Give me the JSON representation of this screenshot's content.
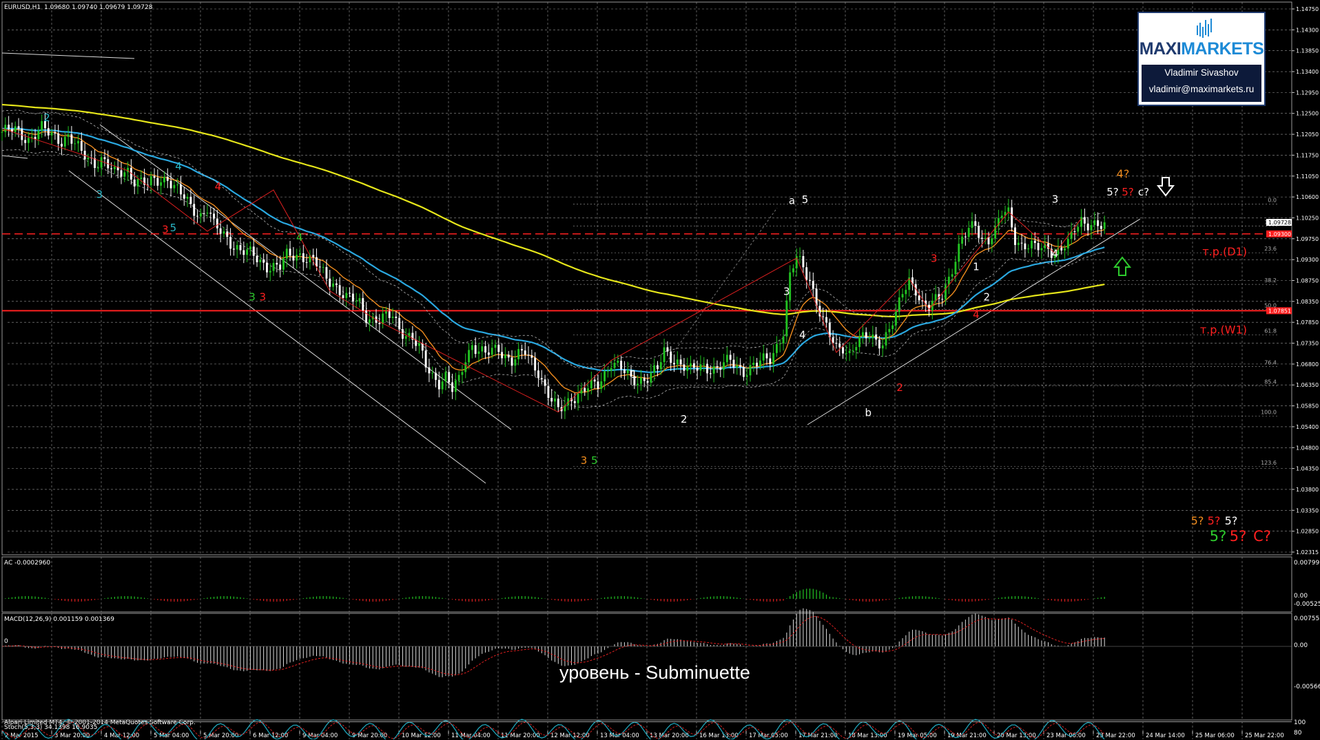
{
  "header": {
    "symbol": "EURUSD,H1",
    "ohlc": "1.09680 1.09740 1.09679 1.09728"
  },
  "logo": {
    "brand_part1": "MAXI",
    "brand_part2": "MARKETS",
    "author": "Vladimir Sivashov",
    "email": "vladimir@maximarkets.ru"
  },
  "footer": {
    "copyright": "Alpari Limited MT4, © 2001-2014 MetaQuotes Software Corp.",
    "level_label": "уровень - Subminuette"
  },
  "indicators": {
    "ac_label": "AC -0.0002960",
    "macd_label": "MACD(12,26,9) 0.001159 0.001369",
    "stoch_label": "Stoch(5,3,3) 34.1398 16.9035",
    "ac_scale": [
      "0.0079954",
      "0.00",
      "-0.005259"
    ],
    "macd_scale": [
      "0.0075534",
      "0.00",
      "-0.005667"
    ],
    "stoch_scale": [
      "100",
      "80",
      "20",
      "0"
    ],
    "macd_zero": "0"
  },
  "colors": {
    "background": "#000000",
    "ema_slow": "#e6e61a",
    "ema_mid": "#2aa8e0",
    "ema_fast": "#f08c1e",
    "bull": "#22c322",
    "level_red": "#ff2020",
    "stoch_main": "#1fa3b8",
    "stoch_signal": "#d02020"
  },
  "chart_data": {
    "type": "candlestick",
    "symbol": "EURUSD",
    "timeframe": "H1",
    "price_axis_ticks": [
      "1.14750",
      "1.14300",
      "1.13850",
      "1.13400",
      "1.12950",
      "1.12500",
      "1.12050",
      "1.11750",
      "1.11050",
      "1.10600",
      "1.10250",
      "1.09750",
      "1.09300",
      "1.08750",
      "1.08350",
      "1.07850",
      "1.07350",
      "1.06800",
      "1.06350",
      "1.05850",
      "1.05400",
      "1.04800",
      "1.04350",
      "1.03800",
      "1.03350",
      "1.02850",
      "1.02315"
    ],
    "price_range": [
      1.0229,
      1.1488
    ],
    "current_price_tag": "1.09728",
    "level_tags": [
      "1.09300",
      "1.07851"
    ],
    "time_labels": [
      "2 Mar 2015",
      "3 Mar 20:00",
      "4 Mar 12:00",
      "5 Mar 04:00",
      "5 Mar 20:00",
      "6 Mar 12:00",
      "9 Mar 04:00",
      "9 Mar 20:00",
      "10 Mar 12:00",
      "11 Mar 04:00",
      "11 Mar 20:00",
      "12 Mar 12:00",
      "13 Mar 04:00",
      "13 Mar 20:00",
      "16 Mar 13:00",
      "17 Mar 05:00",
      "17 Mar 21:00",
      "18 Mar 13:00",
      "19 Mar 05:00",
      "19 Mar 21:00",
      "20 Mar 13:00",
      "23 Mar 06:00",
      "23 Mar 22:00",
      "24 Mar 14:00",
      "25 Mar 06:00",
      "25 Mar 22:00"
    ],
    "fib_levels": [
      {
        "label": "0.0",
        "price": 1.1028
      },
      {
        "label": "11.8",
        "price": 1.0978
      },
      {
        "label": "23.6",
        "price": 1.0917
      },
      {
        "label": "38.2",
        "price": 1.0845
      },
      {
        "label": "50.0",
        "price": 1.0788
      },
      {
        "label": "61.8",
        "price": 1.073
      },
      {
        "label": "76.4",
        "price": 1.0658
      },
      {
        "label": "85.4",
        "price": 1.0614
      },
      {
        "label": "100.0",
        "price": 1.0545
      },
      {
        "label": "123.6",
        "price": 1.043
      }
    ],
    "horizontal_levels": [
      {
        "label": "т.р.(D1)",
        "price": 1.096,
        "style": "dashed"
      },
      {
        "label": "т.р.(W1)",
        "price": 1.0785,
        "style": "solid"
      }
    ],
    "close_path": [
      [
        0,
        1.1192
      ],
      [
        4,
        1.1194
      ],
      [
        8,
        1.1178
      ],
      [
        12,
        1.1198
      ],
      [
        14,
        1.1188
      ],
      [
        18,
        1.1176
      ],
      [
        20,
        1.1184
      ],
      [
        24,
        1.1141
      ],
      [
        28,
        1.1124
      ],
      [
        30,
        1.1132
      ],
      [
        34,
        1.1094
      ],
      [
        38,
        1.1108
      ],
      [
        40,
        1.1084
      ],
      [
        44,
        1.1068
      ],
      [
        46,
        1.1082
      ],
      [
        50,
        1.109
      ],
      [
        52,
        1.1064
      ],
      [
        56,
        1.1032
      ],
      [
        60,
        1.1004
      ],
      [
        62,
        1.1018
      ],
      [
        64,
        1.0976
      ],
      [
        68,
        1.0952
      ],
      [
        72,
        1.0922
      ],
      [
        76,
        1.0908
      ],
      [
        80,
        1.089
      ],
      [
        84,
        1.0882
      ],
      [
        86,
        1.0908
      ],
      [
        90,
        1.0916
      ],
      [
        94,
        1.0896
      ],
      [
        98,
        1.086
      ],
      [
        100,
        1.0852
      ],
      [
        104,
        1.0812
      ],
      [
        108,
        1.0802
      ],
      [
        110,
        1.0776
      ],
      [
        114,
        1.076
      ],
      [
        118,
        1.0774
      ],
      [
        120,
        1.0748
      ],
      [
        124,
        1.072
      ],
      [
        126,
        1.0696
      ],
      [
        128,
        1.066
      ],
      [
        130,
        1.064
      ],
      [
        132,
        1.0625
      ],
      [
        134,
        1.0634
      ],
      [
        136,
        1.0602
      ],
      [
        138,
        1.0624
      ],
      [
        140,
        1.068
      ],
      [
        142,
        1.071
      ],
      [
        146,
        1.0682
      ],
      [
        150,
        1.07
      ],
      [
        154,
        1.0672
      ],
      [
        158,
        1.0688
      ],
      [
        162,
        1.065
      ],
      [
        164,
        1.061
      ],
      [
        166,
        1.0578
      ],
      [
        168,
        1.0554
      ],
      [
        170,
        1.057
      ],
      [
        172,
        1.059
      ],
      [
        176,
        1.0604
      ],
      [
        180,
        1.0616
      ],
      [
        184,
        1.0672
      ],
      [
        186,
        1.0658
      ],
      [
        190,
        1.0626
      ],
      [
        194,
        1.0632
      ],
      [
        198,
        1.0648
      ],
      [
        200,
        1.069
      ],
      [
        204,
        1.0672
      ],
      [
        208,
        1.0646
      ],
      [
        212,
        1.066
      ],
      [
        216,
        1.0654
      ],
      [
        220,
        1.0668
      ],
      [
        224,
        1.065
      ],
      [
        228,
        1.0662
      ],
      [
        232,
        1.0676
      ],
      [
        236,
        1.074
      ],
      [
        238,
        1.086
      ],
      [
        240,
        1.0905
      ],
      [
        242,
        1.0882
      ],
      [
        244,
        1.086
      ],
      [
        246,
        1.0806
      ],
      [
        248,
        1.076
      ],
      [
        250,
        1.0724
      ],
      [
        252,
        1.0698
      ],
      [
        254,
        1.0706
      ],
      [
        256,
        1.069
      ],
      [
        258,
        1.071
      ],
      [
        262,
        1.0726
      ],
      [
        266,
        1.0716
      ],
      [
        270,
        1.077
      ],
      [
        272,
        1.0824
      ],
      [
        274,
        1.0858
      ],
      [
        276,
        1.0838
      ],
      [
        278,
        1.0798
      ],
      [
        280,
        1.0788
      ],
      [
        284,
        1.0824
      ],
      [
        286,
        1.0864
      ],
      [
        290,
        1.0944
      ],
      [
        292,
        1.0966
      ],
      [
        294,
        1.0984
      ],
      [
        296,
        1.0952
      ],
      [
        298,
        1.0948
      ],
      [
        300,
        1.0962
      ],
      [
        302,
        1.1004
      ],
      [
        304,
        1.101
      ],
      [
        306,
        1.0954
      ],
      [
        308,
        1.0934
      ],
      [
        312,
        1.0925
      ],
      [
        316,
        1.0934
      ],
      [
        318,
        1.0916
      ],
      [
        322,
        1.0932
      ],
      [
        324,
        1.0972
      ],
      [
        326,
        1.0995
      ],
      [
        330,
        1.0978
      ],
      [
        332,
        1.0972
      ]
    ],
    "bars_total": 334,
    "wave_labels": [
      {
        "text": "2",
        "bar": 17,
        "price": 1.1217,
        "color": "#2ab8c8"
      },
      {
        "text": "3",
        "bar": 37,
        "price": 1.1042,
        "color": "#2ab8c8"
      },
      {
        "text": "4",
        "bar": 67,
        "price": 1.1106,
        "color": "#2ab8c8"
      },
      {
        "text": "5",
        "bar": 65,
        "price": 1.0966,
        "color": "#2ab8c8"
      },
      {
        "text": "3",
        "bar": 62,
        "price": 1.0962,
        "color": "#ff2020"
      },
      {
        "text": "4",
        "bar": 82,
        "price": 1.106,
        "color": "#ff2020"
      },
      {
        "text": "4",
        "bar": 113,
        "price": 1.0944,
        "color": "#2ecc2e"
      },
      {
        "text": "3",
        "bar": 95,
        "price": 1.0808,
        "color": "#2ecc2e"
      },
      {
        "text": "3",
        "bar": 99,
        "price": 1.0808,
        "color": "#ff2020"
      },
      {
        "text": "3",
        "bar": 221,
        "price": 1.0436,
        "color": "#f08c1e"
      },
      {
        "text": "5",
        "bar": 225,
        "price": 1.0436,
        "color": "#2ecc2e"
      },
      {
        "text": "1",
        "bar": 240,
        "price": 1.0632,
        "color": "#ffffff"
      },
      {
        "text": "2",
        "bar": 259,
        "price": 1.053,
        "color": "#ffffff"
      },
      {
        "text": "a",
        "bar": 300,
        "price": 1.1028,
        "color": "#ffffff"
      },
      {
        "text": "5",
        "bar": 305,
        "price": 1.103,
        "color": "#ffffff"
      },
      {
        "text": "3",
        "bar": 298,
        "price": 1.0821,
        "color": "#ffffff"
      },
      {
        "text": "4",
        "bar": 304,
        "price": 1.0722,
        "color": "#ffffff"
      },
      {
        "text": "b",
        "bar": 329,
        "price": 1.0545,
        "color": "#ffffff"
      },
      {
        "text": "2",
        "bar": 341,
        "price": 1.0602,
        "color": "#ff2020"
      },
      {
        "text": "3",
        "bar": 354,
        "price": 1.0896,
        "color": "#ff2020"
      },
      {
        "text": "1",
        "bar": 370,
        "price": 1.0877,
        "color": "#ffffff"
      },
      {
        "text": "2",
        "bar": 374,
        "price": 1.0808,
        "color": "#ffffff"
      },
      {
        "text": "4",
        "bar": 370,
        "price": 1.0768,
        "color": "#ff2020"
      },
      {
        "text": "3",
        "bar": 400,
        "price": 1.1031,
        "color": "#ffffff"
      },
      {
        "text": "4",
        "bar": 400,
        "price": 1.0907,
        "color": "#ffffff"
      }
    ],
    "forecast_labels": [
      {
        "text": "4?",
        "color": "#f08c1e"
      },
      {
        "text": "5?",
        "color": "#ffffff"
      },
      {
        "text": "5?",
        "color": "#ff2020"
      },
      {
        "text": "c?",
        "color": "#ffffff"
      },
      {
        "text": "5?",
        "color": "#f08c1e"
      },
      {
        "text": "5?",
        "color": "#ff2020"
      },
      {
        "text": "5?",
        "color": "#ffffff"
      },
      {
        "text": "5?",
        "color": "#2ecc2e"
      },
      {
        "text": "5?",
        "color": "#ff2020"
      },
      {
        "text": "C?",
        "color": "#ff2020"
      }
    ]
  }
}
